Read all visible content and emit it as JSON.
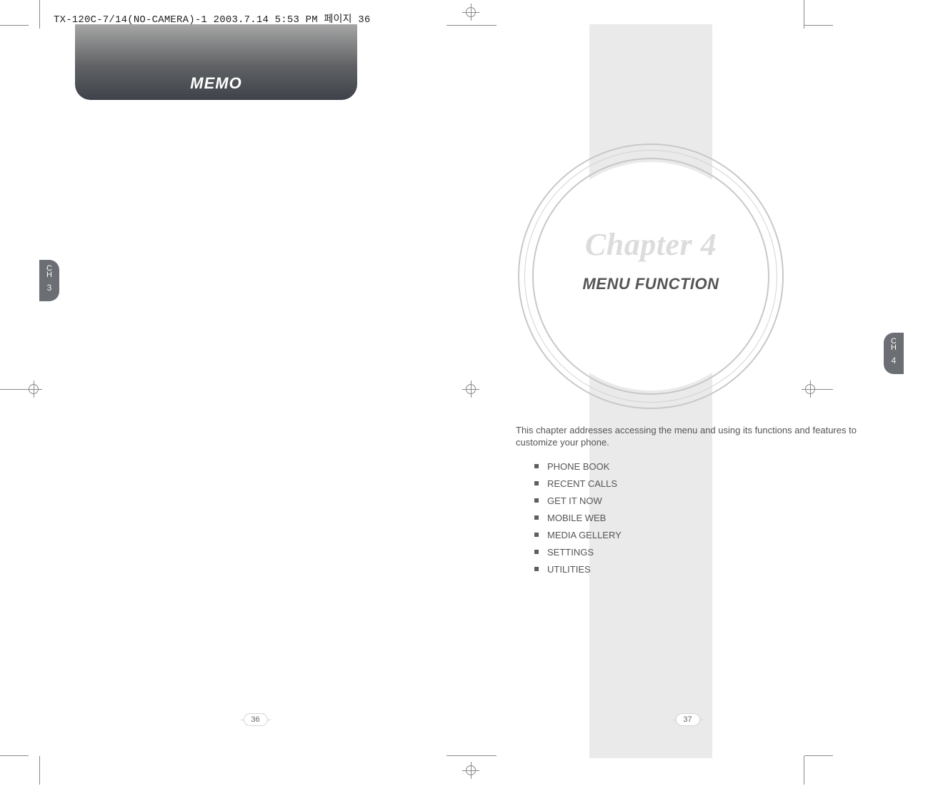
{
  "print_header": "TX-120C-7/14(NO-CAMERA)-1  2003.7.14 5:53 PM  페이지 36",
  "left_page": {
    "memo_title": "MEMO",
    "ch_label_C": "C",
    "ch_label_H": "H",
    "ch_number": "3",
    "page_number": "36"
  },
  "right_page": {
    "chapter_title": "Chapter 4",
    "chapter_subtitle": "MENU FUNCTION",
    "intro": "This chapter addresses accessing the menu and using its functions and features to customize your phone.",
    "menu_items": [
      "PHONE BOOK",
      "RECENT CALLS",
      "GET IT NOW",
      "MOBILE WEB",
      "MEDIA GELLERY",
      "SETTINGS",
      "UTILITIES"
    ],
    "ch_label_C": "C",
    "ch_label_H": "H",
    "ch_number": "4",
    "page_number": "37"
  }
}
